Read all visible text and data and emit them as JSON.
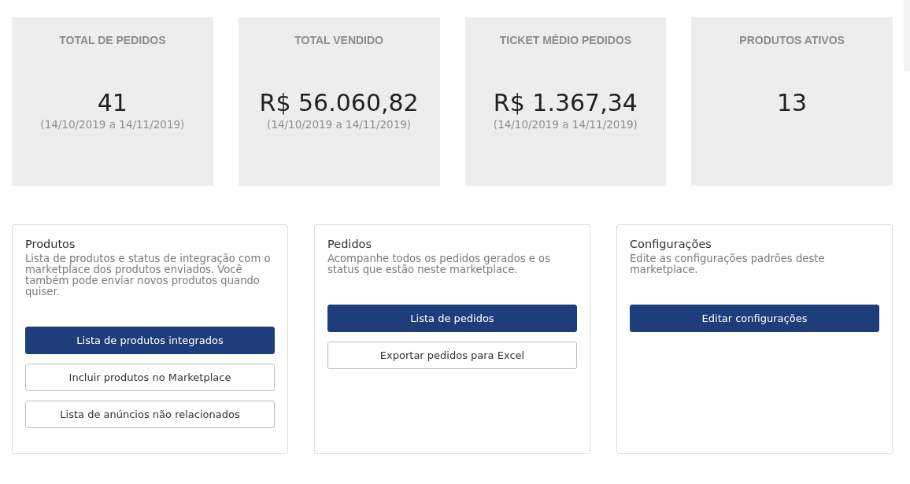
{
  "stats": [
    {
      "title": "TOTAL DE PEDIDOS",
      "value": "41",
      "period": "(14/10/2019 a 14/11/2019)"
    },
    {
      "title": "TOTAL VENDIDO",
      "value": "R$ 56.060,82",
      "period": "(14/10/2019 a 14/11/2019)"
    },
    {
      "title": "TICKET MÉDIO PEDIDOS",
      "value": "R$ 1.367,34",
      "period": "(14/10/2019 a 14/11/2019)"
    },
    {
      "title": "PRODUTOS ATIVOS",
      "value": "13"
    }
  ],
  "panels": [
    {
      "title": "Produtos",
      "description": "Lista de produtos e status de integração com o marketplace dos produtos enviados. Você também pode enviar novos produtos quando quiser.",
      "buttons": [
        {
          "label": "Lista de produtos integrados",
          "kind": "primary"
        },
        {
          "label": "Incluir produtos no Marketplace",
          "kind": "outline"
        },
        {
          "label": "Lista de anúncios não relacionados",
          "kind": "outline"
        }
      ]
    },
    {
      "title": "Pedidos",
      "description": "Acompanhe todos os pedidos gerados e os status que estão neste marketplace.",
      "buttons": [
        {
          "label": "Lista de pedidos",
          "kind": "primary"
        },
        {
          "label": "Exportar pedidos para Excel",
          "kind": "outline"
        }
      ]
    },
    {
      "title": "Configurações",
      "description": "Edite as configurações padrões deste marketplace.",
      "buttons": [
        {
          "label": "Editar configurações",
          "kind": "primary"
        }
      ]
    }
  ]
}
